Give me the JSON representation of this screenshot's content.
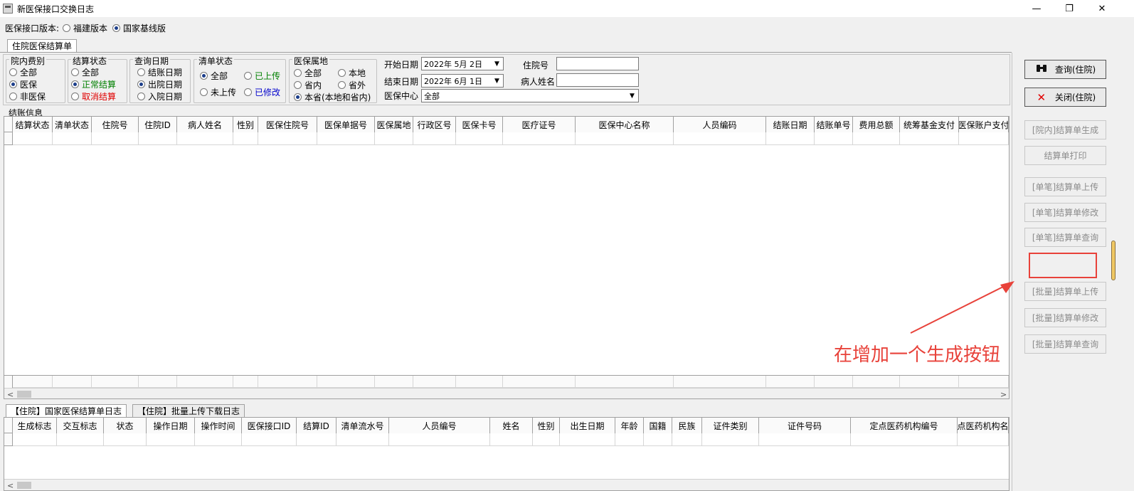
{
  "window": {
    "title": "新医保接口交换日志",
    "minimize": "—",
    "maximize": "❐",
    "close": "✕"
  },
  "version": {
    "label": "医保接口版本:",
    "options": [
      "福建版本",
      "国家基线版"
    ],
    "selected": 1
  },
  "main_tab": "住院医保结算单",
  "filters": {
    "fee_type": {
      "title": "院内费别",
      "options": [
        "全部",
        "医保",
        "非医保"
      ],
      "selected": 1
    },
    "settle_status": {
      "title": "结算状态",
      "options": [
        "全部",
        "正常结算",
        "取消结算"
      ],
      "selected": 1,
      "colors": [
        "#000000",
        "#008000",
        "#e00000"
      ]
    },
    "query_date": {
      "title": "查询日期",
      "options": [
        "结账日期",
        "出院日期",
        "入院日期"
      ],
      "selected": 1
    },
    "list_status": {
      "title": "清单状态",
      "options": [
        "全部",
        "已上传",
        "未上传",
        "已修改"
      ],
      "selected": 0,
      "colors": [
        "#000000",
        "#008000",
        "#000000",
        "#0000cc"
      ]
    },
    "insurance_region": {
      "title": "医保属地",
      "options": [
        "全部",
        "本地",
        "省内",
        "省外",
        "本省(本地和省内)"
      ],
      "selected": 4
    },
    "start_date": {
      "label": "开始日期",
      "value": "2022年 5月 2日"
    },
    "end_date": {
      "label": "结束日期",
      "value": "2022年 6月 1日"
    },
    "center": {
      "label": "医保中心",
      "value": "全部"
    },
    "inpatient_no": {
      "label": "住院号",
      "value": ""
    },
    "patient_name": {
      "label": "病人姓名",
      "value": ""
    }
  },
  "settle_grid": {
    "caption": "结账信息",
    "columns": [
      "结算状态",
      "清单状态",
      "住院号",
      "住院ID",
      "病人姓名",
      "性别",
      "医保住院号",
      "医保单据号",
      "医保属地",
      "行政区号",
      "医保卡号",
      "医疗证号",
      "医保中心名称",
      "人员编码",
      "结账日期",
      "结账单号",
      "费用总额",
      "统筹基金支付",
      "医保账户支付"
    ]
  },
  "log_tabs": [
    "【住院】国家医保结算单日志",
    "【住院】批量上传下载日志"
  ],
  "log_grid": {
    "columns": [
      "生成标志",
      "交互标志",
      "状态",
      "操作日期",
      "操作时间",
      "医保接口ID",
      "结算ID",
      "清单流水号",
      "人员编号",
      "姓名",
      "性别",
      "出生日期",
      "年龄",
      "国籍",
      "民族",
      "证件类别",
      "证件号码",
      "定点医药机构编号",
      "定点医药机构名称"
    ]
  },
  "buttons": {
    "query": "查询(住院)",
    "close": "关闭(住院)",
    "generate": "[院内]结算单生成",
    "print": "结算单打印",
    "single_upload": "[单笔]结算单上传",
    "single_modify": "[单笔]结算单修改",
    "single_query": "[单笔]结算单查询",
    "batch_upload": "[批量]结算单上传",
    "batch_modify": "[批量]结算单修改",
    "batch_query": "[批量]结算单查询"
  },
  "annotation": {
    "text": "在增加一个生成按钮",
    "color": "#e8423a"
  }
}
